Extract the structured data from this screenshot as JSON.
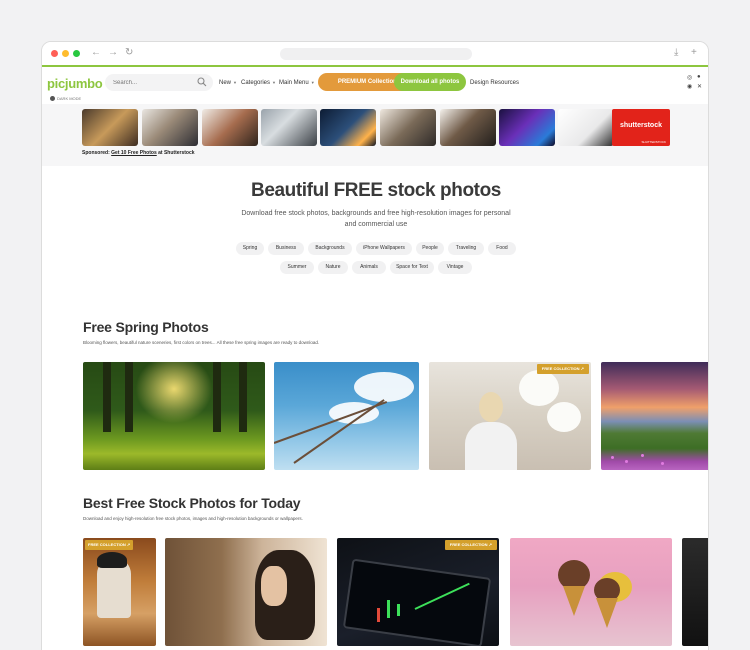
{
  "browser": {
    "back_icon": "←",
    "forward_icon": "→",
    "reload_icon": "↻",
    "download_icon": "⤓",
    "newtab_icon": "+"
  },
  "header": {
    "logo": "picjumbo",
    "search_placeholder": "Search...",
    "nav": [
      {
        "label": "New"
      },
      {
        "label": "Categories"
      },
      {
        "label": "Main Menu"
      }
    ],
    "premium_label": "PREMIUM Collections",
    "download_label": "Download all photos",
    "design_resources": "Design Resources",
    "dark_mode": "DARK MODE"
  },
  "ad": {
    "sponsored_prefix": "Sponsored:",
    "sponsored_link": "Get 10 Free Photos",
    "sponsored_suffix": "at Shutterstock",
    "shutterstock_logo": "shutterstock",
    "shutterstock_tagline": "SHUTTERSTOCK"
  },
  "hero": {
    "title": "Beautiful FREE stock photos",
    "subtitle": "Download free stock photos, backgrounds and free high-resolution images for personal and commercial use",
    "tags_row1": [
      "Spring",
      "Business",
      "Backgrounds",
      "iPhone Wallpapers",
      "People",
      "Traveling",
      "Food"
    ],
    "tags_row2": [
      "Summer",
      "Nature",
      "Animals",
      "Space for Text",
      "Vintage"
    ]
  },
  "sections": [
    {
      "title": "Free Spring Photos",
      "description": "Blooming flowers, beautiful nature sceneries, first colors on trees... All these free spring images are ready to download."
    },
    {
      "title": "Best Free Stock Photos for Today",
      "description": "Download and enjoy high-resolution free stock photos, images and high-resolution backgrounds or wallpapers."
    }
  ],
  "badges": {
    "free_collection": "FREE COLLECTION ↗"
  },
  "colors": {
    "brand_green": "#8dc63f",
    "premium_orange": "#e39a3b",
    "badge_gold": "#d4a02c",
    "shutterstock_red": "#e2231a"
  }
}
